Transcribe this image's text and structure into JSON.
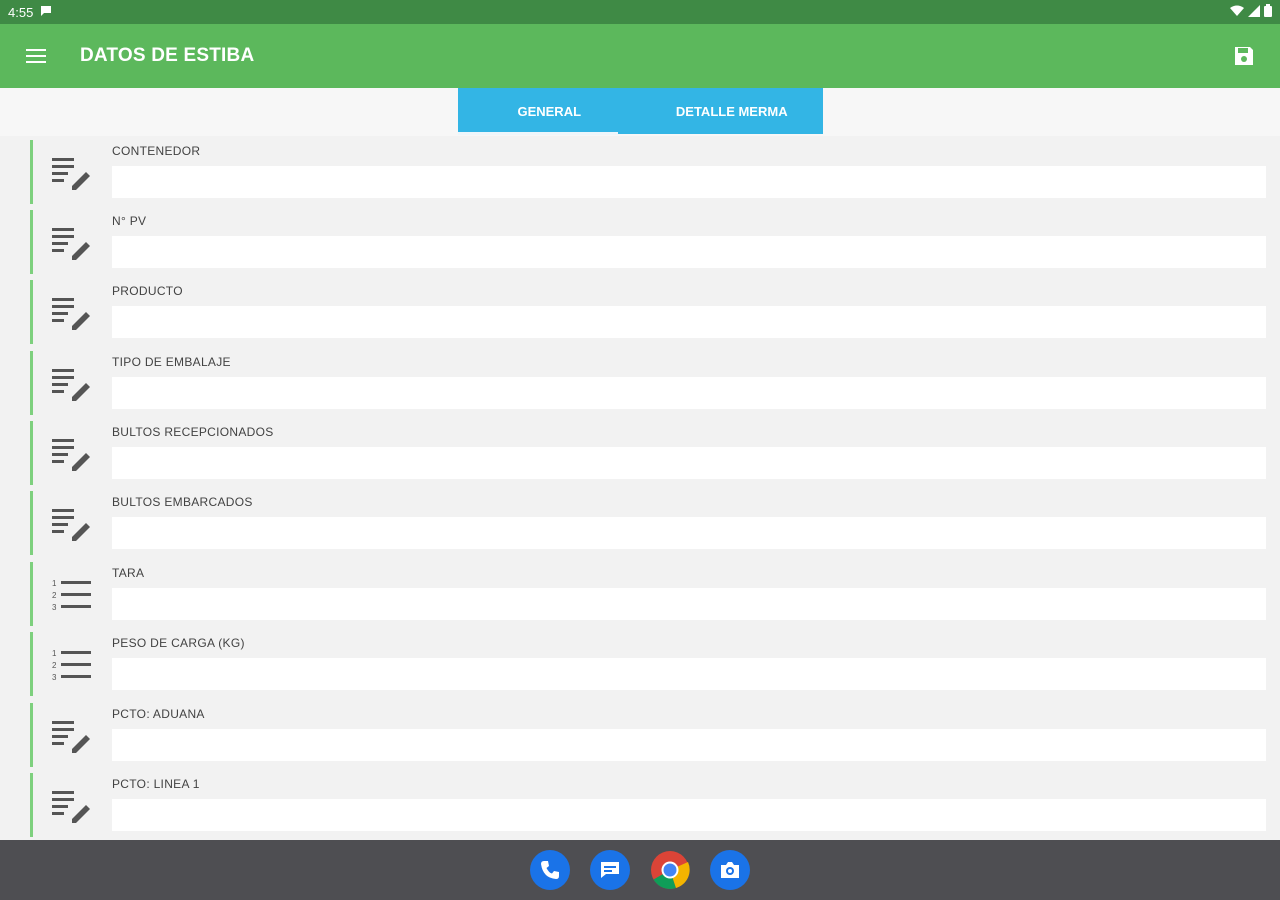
{
  "status_bar": {
    "time": "4:55"
  },
  "app_bar": {
    "title": "DATOS DE ESTIBA"
  },
  "tabs": [
    {
      "label": "GENERAL",
      "selected": true
    },
    {
      "label": "DETALLE MERMA",
      "selected": false
    }
  ],
  "fields": [
    {
      "label": "CONTENEDOR",
      "icon": "notes-edit-icon",
      "value": ""
    },
    {
      "label": "N° PV",
      "icon": "notes-edit-icon",
      "value": ""
    },
    {
      "label": "PRODUCTO",
      "icon": "notes-edit-icon",
      "value": ""
    },
    {
      "label": "TIPO DE EMBALAJE",
      "icon": "notes-edit-icon",
      "value": ""
    },
    {
      "label": "BULTOS RECEPCIONADOS",
      "icon": "notes-edit-icon",
      "value": ""
    },
    {
      "label": "BULTOS EMBARCADOS",
      "icon": "notes-edit-icon",
      "value": ""
    },
    {
      "label": "TARA",
      "icon": "numbered-list-icon",
      "value": ""
    },
    {
      "label": "PESO DE CARGA (KG)",
      "icon": "numbered-list-icon",
      "value": ""
    },
    {
      "label": "PCTO: ADUANA",
      "icon": "notes-edit-icon",
      "value": ""
    },
    {
      "label": "PCTO: LINEA 1",
      "icon": "notes-edit-icon",
      "value": ""
    }
  ],
  "dock": [
    {
      "name": "phone-app-icon"
    },
    {
      "name": "messages-app-icon"
    },
    {
      "name": "chrome-app-icon"
    },
    {
      "name": "camera-app-icon"
    }
  ],
  "colors": {
    "app_bar": "#5cb85c",
    "status_bar": "#3f8a45",
    "tab_bg": "#33b5e5",
    "row_accent": "#7ed07e",
    "nav_bar": "#4e4e52"
  }
}
